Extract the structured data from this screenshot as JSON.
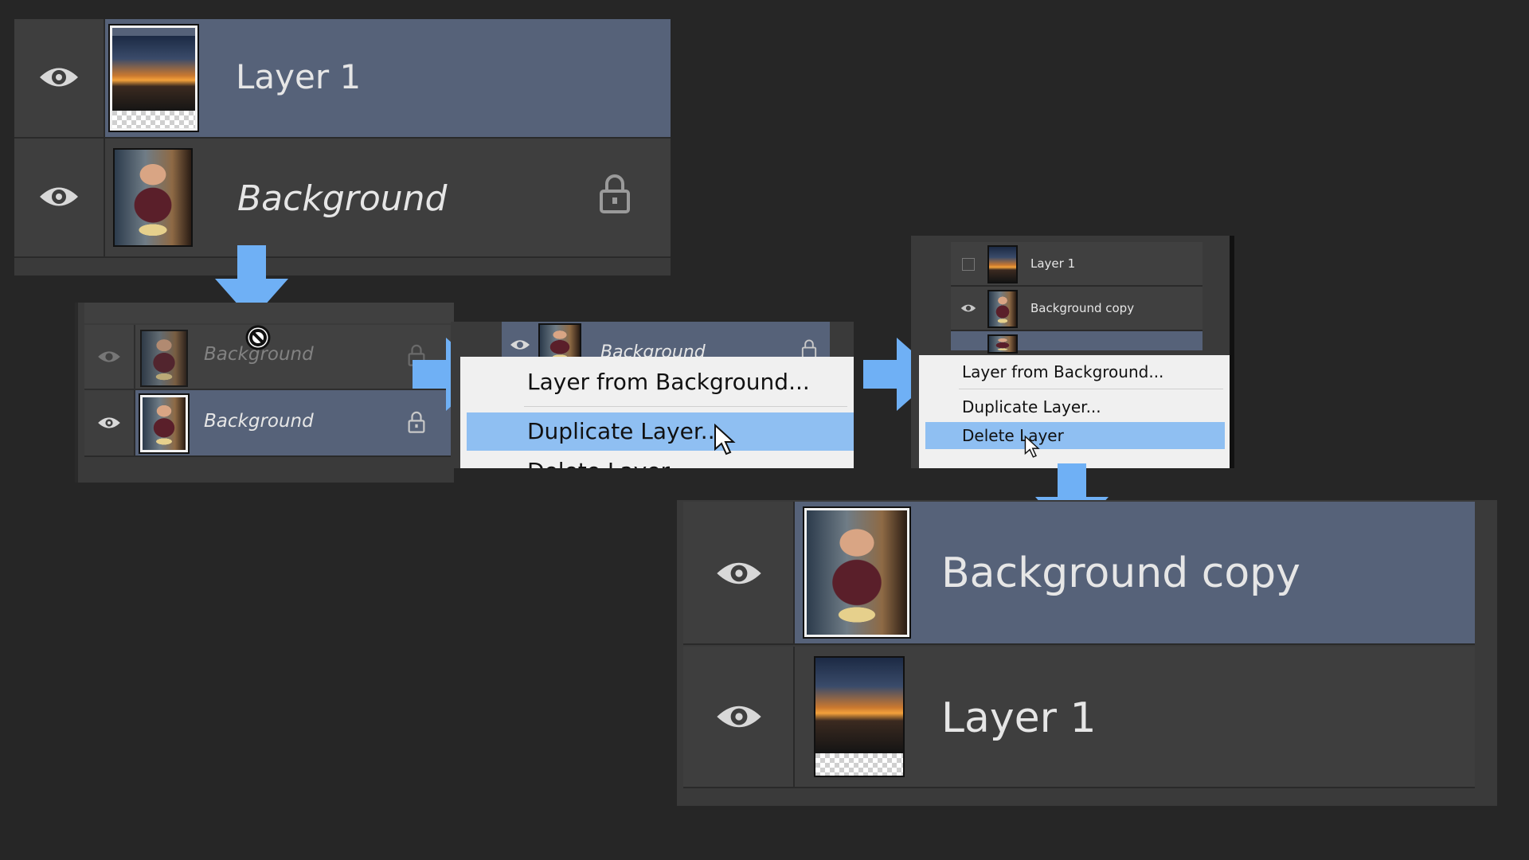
{
  "panel_top": {
    "layers": [
      {
        "name": "Layer 1",
        "selected": true,
        "thumb": "sunset",
        "italic": false
      },
      {
        "name": "Background",
        "selected": false,
        "thumb": "portrait",
        "italic": true,
        "locked": true
      }
    ]
  },
  "panel_drag": {
    "ghost_label": "Background",
    "ghost_label_overlay": "Background",
    "layer_name": "Background",
    "cursor": "not-allowed-icon"
  },
  "menu_mid": {
    "header_layer": "Background",
    "items": [
      "Layer from Background...",
      "Duplicate Layer...",
      "Delete Layer"
    ],
    "highlighted": "Duplicate Layer..."
  },
  "panel_right": {
    "layers": [
      "Layer 1",
      "Background copy"
    ],
    "menu_items": [
      "Layer from Background...",
      "Duplicate Layer...",
      "Delete Layer"
    ],
    "highlighted": "Delete Layer"
  },
  "panel_result": {
    "layers": [
      {
        "name": "Background copy",
        "selected": true,
        "thumb": "portrait"
      },
      {
        "name": "Layer 1",
        "selected": false,
        "thumb": "sunset"
      }
    ]
  },
  "colors": {
    "arrow": "#6fb0f5",
    "selected_row": "#566279",
    "menu_highlight": "#8fbff2"
  }
}
